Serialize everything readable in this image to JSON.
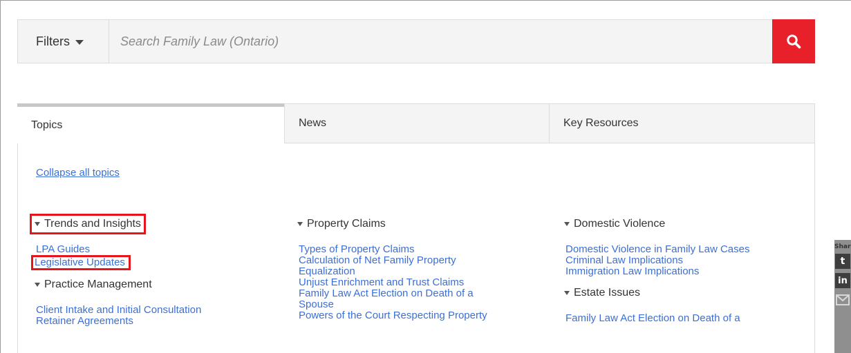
{
  "search": {
    "filters_label": "Filters",
    "placeholder": "Search Family Law (Ontario)"
  },
  "tabs": [
    {
      "label": "Topics"
    },
    {
      "label": "News"
    },
    {
      "label": "Key Resources"
    }
  ],
  "collapse_label": "Collapse all topics",
  "columns": [
    {
      "sections": [
        {
          "heading": "Trends and Insights",
          "items": [
            "LPA Guides",
            "Legislative Updates"
          ]
        },
        {
          "heading": "Practice Management",
          "items": [
            "Client Intake and Initial Consultation",
            "Retainer Agreements"
          ]
        }
      ]
    },
    {
      "sections": [
        {
          "heading": "Property Claims",
          "items": [
            "Types of Property Claims",
            "Calculation of Net Family Property",
            "Equalization",
            "Unjust Enrichment and Trust Claims",
            "Family Law Act Election on Death of a",
            "Spouse",
            "Powers of the Court Respecting Property"
          ]
        }
      ]
    },
    {
      "sections": [
        {
          "heading": "Domestic Violence",
          "items": [
            "Domestic Violence in Family Law Cases",
            "Criminal Law Implications",
            "Immigration Law Implications"
          ]
        },
        {
          "heading": "Estate Issues",
          "items": [
            "Family Law Act Election on Death of a"
          ]
        }
      ]
    }
  ],
  "share": {
    "label": "Share",
    "twitter": "t",
    "linkedin": "in"
  },
  "colors": {
    "accent_red": "#e8202a",
    "link_blue": "#3b6fd4",
    "highlight_red": "#e8141c"
  },
  "icons": {
    "search": "search-icon",
    "filters_caret": "caret-down-icon",
    "twitter": "twitter-icon",
    "linkedin": "linkedin-icon",
    "email": "email-icon"
  }
}
